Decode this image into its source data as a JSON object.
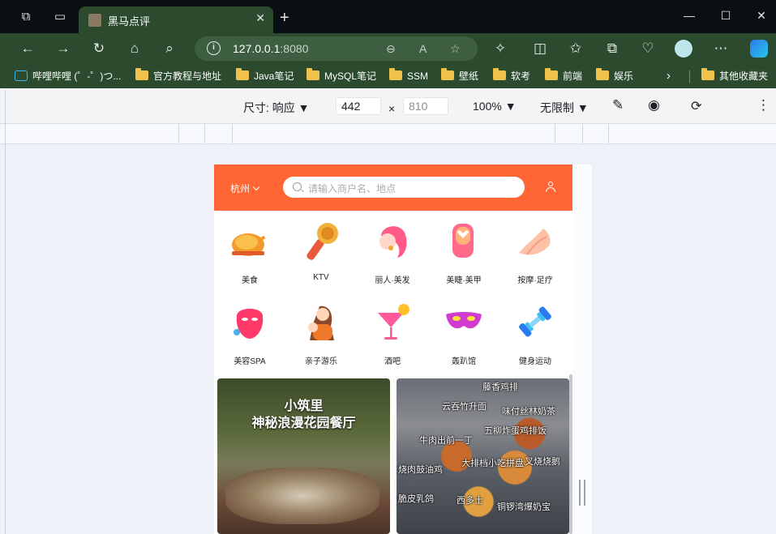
{
  "browser": {
    "tab_title": "黑马点评",
    "address_host": "127.0.0.1",
    "address_port": ":8080",
    "bookmarks": [
      {
        "label": "哔哩哔哩 (゜-゜)つ...",
        "kind": "bilibili"
      },
      {
        "label": "官方教程与地址",
        "kind": "folder"
      },
      {
        "label": "Java笔记",
        "kind": "folder"
      },
      {
        "label": "MySQL笔记",
        "kind": "folder"
      },
      {
        "label": "SSM",
        "kind": "folder"
      },
      {
        "label": "壁纸",
        "kind": "folder"
      },
      {
        "label": "软考",
        "kind": "folder"
      },
      {
        "label": "前端",
        "kind": "folder"
      },
      {
        "label": "娱乐",
        "kind": "folder"
      }
    ],
    "other_bookmarks": "其他收藏夹"
  },
  "devtools": {
    "size_label": "尺寸: 响应",
    "width": "442",
    "times": "×",
    "height": "810",
    "zoom": "100%",
    "throttle": "无限制"
  },
  "app": {
    "city": "杭州",
    "search_placeholder": "请输入商户名、地点",
    "categories": [
      {
        "label": "美食",
        "icon": "roast-chicken-icon"
      },
      {
        "label": "KTV",
        "icon": "microphone-icon"
      },
      {
        "label": "丽人·美发",
        "icon": "hair-icon"
      },
      {
        "label": "美睫·美甲",
        "icon": "nail-icon"
      },
      {
        "label": "按摩·足疗",
        "icon": "massage-icon"
      },
      {
        "label": "美容SPA",
        "icon": "face-mask-icon"
      },
      {
        "label": "亲子游乐",
        "icon": "parent-child-icon"
      },
      {
        "label": "酒吧",
        "icon": "cocktail-icon"
      },
      {
        "label": "轰趴馆",
        "icon": "party-mask-icon"
      },
      {
        "label": "健身运动",
        "icon": "dumbbell-icon"
      }
    ],
    "cards": [
      {
        "title_line1": "小筑里",
        "title_line2": "神秘浪漫花园餐厅"
      },
      {
        "labels": [
          "藤香鸡排",
          "云吞竹升面",
          "味付丝林奶茶",
          "牛肉出前一丁",
          "五柳炸蛋鸡排饭",
          "烧肉鼓油鸡",
          "大排档小吃拼盘",
          "叉烧烧鹅",
          "脆皮乳鸽",
          "西多士",
          "铜锣湾爆奶宝"
        ]
      }
    ]
  }
}
